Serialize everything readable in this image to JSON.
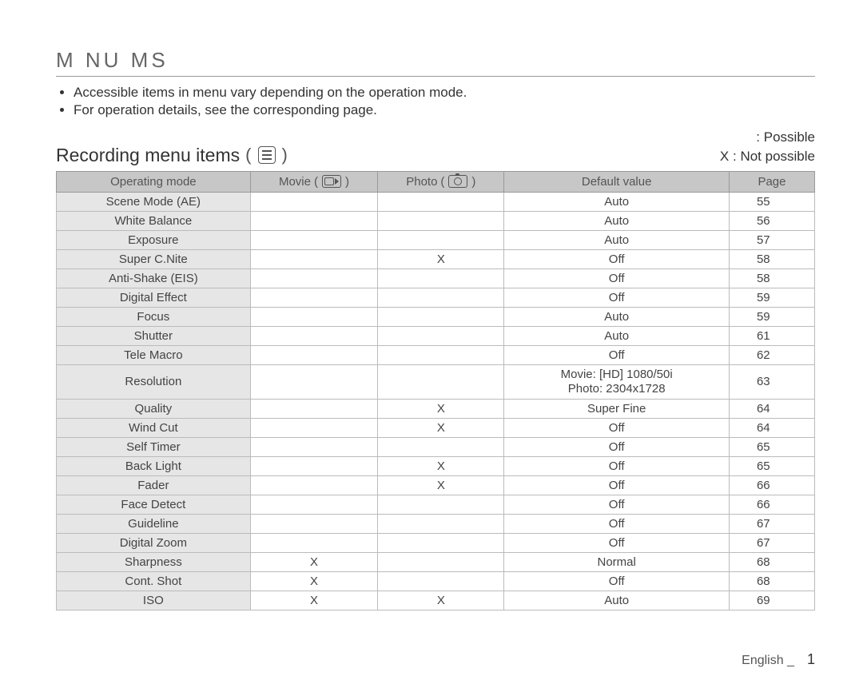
{
  "section_title": "M  NU      MS",
  "bullets": [
    "Accessible items in menu vary depending on the operation mode.",
    "For operation details, see the corresponding page."
  ],
  "subheading": "Recording menu items",
  "legend": {
    "possible": ": Possible",
    "not_possible_prefix": "X",
    "not_possible": ": Not possible"
  },
  "columns": {
    "mode": "Operating mode",
    "movie": "Movie",
    "photo": "Photo",
    "default": "Default value",
    "page": "Page"
  },
  "rows": [
    {
      "name": "Scene Mode (AE)",
      "movie": "",
      "photo": "",
      "def": "Auto",
      "page": "55"
    },
    {
      "name": "White Balance",
      "movie": "",
      "photo": "",
      "def": "Auto",
      "page": "56"
    },
    {
      "name": "Exposure",
      "movie": "",
      "photo": "",
      "def": "Auto",
      "page": "57"
    },
    {
      "name": "Super C.Nite",
      "movie": "",
      "photo": "X",
      "def": "Off",
      "page": "58"
    },
    {
      "name": "Anti-Shake (EIS)",
      "movie": "",
      "photo": "",
      "def": "Off",
      "page": "58"
    },
    {
      "name": "Digital Effect",
      "movie": "",
      "photo": "",
      "def": "Off",
      "page": "59"
    },
    {
      "name": "Focus",
      "movie": "",
      "photo": "",
      "def": "Auto",
      "page": "59"
    },
    {
      "name": "Shutter",
      "movie": "",
      "photo": "",
      "def": "Auto",
      "page": "61"
    },
    {
      "name": "Tele Macro",
      "movie": "",
      "photo": "",
      "def": "Off",
      "page": "62"
    },
    {
      "name": "Resolution",
      "movie": "",
      "photo": "",
      "def": "Movie: [HD] 1080/50i\nPhoto: 2304x1728",
      "page": "63"
    },
    {
      "name": "Quality",
      "movie": "",
      "photo": "X",
      "def": "Super Fine",
      "page": "64"
    },
    {
      "name": "Wind Cut",
      "movie": "",
      "photo": "X",
      "def": "Off",
      "page": "64"
    },
    {
      "name": "Self Timer",
      "movie": "",
      "photo": "",
      "def": "Off",
      "page": "65"
    },
    {
      "name": "Back Light",
      "movie": "",
      "photo": "X",
      "def": "Off",
      "page": "65"
    },
    {
      "name": "Fader",
      "movie": "",
      "photo": "X",
      "def": "Off",
      "page": "66"
    },
    {
      "name": "Face Detect",
      "movie": "",
      "photo": "",
      "def": "Off",
      "page": "66"
    },
    {
      "name": "Guideline",
      "movie": "",
      "photo": "",
      "def": "Off",
      "page": "67"
    },
    {
      "name": "Digital Zoom",
      "movie": "",
      "photo": "",
      "def": "Off",
      "page": "67"
    },
    {
      "name": "Sharpness",
      "movie": "X",
      "photo": "",
      "def": "Normal",
      "page": "68"
    },
    {
      "name": "Cont. Shot",
      "movie": "X",
      "photo": "",
      "def": "Off",
      "page": "68"
    },
    {
      "name": "ISO",
      "movie": "X",
      "photo": "X",
      "def": "Auto",
      "page": "69"
    }
  ],
  "footer": {
    "lang": "English _",
    "page_no": "1"
  }
}
